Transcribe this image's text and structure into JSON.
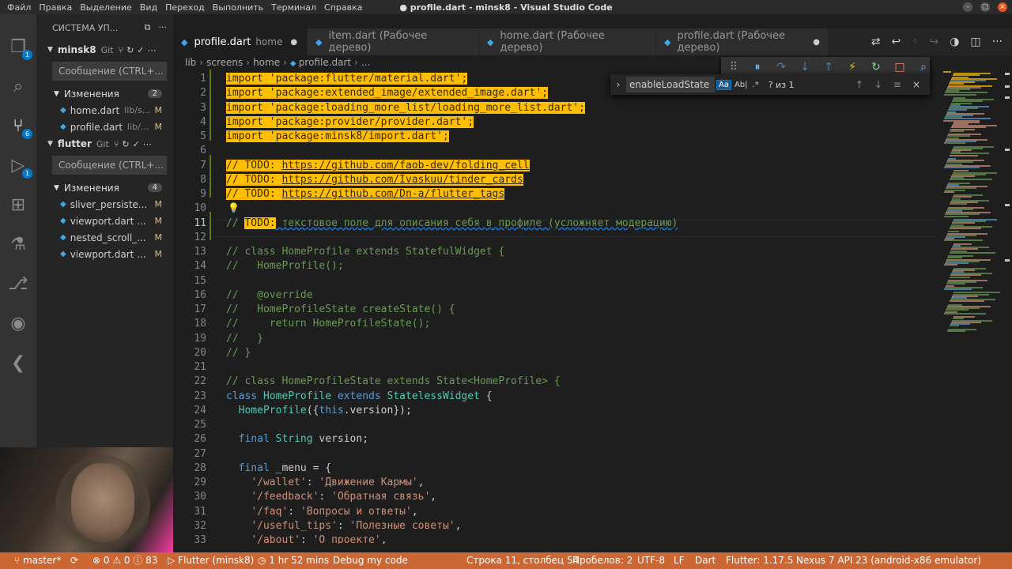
{
  "window": {
    "title": "● profile.dart - minsk8 - Visual Studio Code"
  },
  "menu": [
    "Файл",
    "Правка",
    "Выделение",
    "Вид",
    "Переход",
    "Выполнить",
    "Терминал",
    "Справка"
  ],
  "activity": [
    {
      "name": "explorer-icon",
      "badge": "1"
    },
    {
      "name": "search-icon",
      "badge": ""
    },
    {
      "name": "source-control-icon",
      "badge": "6"
    },
    {
      "name": "run-debug-icon",
      "badge": "1"
    },
    {
      "name": "extensions-icon",
      "badge": ""
    },
    {
      "name": "testing-flask-icon",
      "badge": ""
    },
    {
      "name": "git-graph-icon",
      "badge": ""
    },
    {
      "name": "docker-icon",
      "badge": ""
    },
    {
      "name": "flutter-icon",
      "badge": ""
    }
  ],
  "sidebar": {
    "title": "СИСТЕМА УП...",
    "repos": [
      {
        "name": "minsk8",
        "tag": "Git",
        "message_placeholder": "Сообщение (CTRL+...",
        "changes_label": "Изменения",
        "changes_count": "2",
        "files": [
          {
            "name": "home.dart",
            "path": "lib/s...",
            "status": "M"
          },
          {
            "name": "profile.dart",
            "path": "lib/...",
            "status": "M"
          }
        ]
      },
      {
        "name": "flutter",
        "tag": "Git",
        "message_placeholder": "Сообщение (CTRL+...",
        "changes_label": "Изменения",
        "changes_count": "4",
        "files": [
          {
            "name": "sliver_persiste...",
            "path": "",
            "status": "M"
          },
          {
            "name": "viewport.dart ...",
            "path": "",
            "status": "M"
          },
          {
            "name": "nested_scroll_...",
            "path": "",
            "status": "M"
          },
          {
            "name": "viewport.dart ...",
            "path": "",
            "status": "M"
          }
        ]
      }
    ]
  },
  "tabs": [
    {
      "label": "profile.dart",
      "sub": "home",
      "dirty": "●",
      "active": true
    },
    {
      "label": "item.dart (Рабочее дерево)",
      "sub": "",
      "dirty": "",
      "active": false
    },
    {
      "label": "home.dart (Рабочее дерево)",
      "sub": "",
      "dirty": "",
      "active": false
    },
    {
      "label": "profile.dart (Рабочее дерево)",
      "sub": "",
      "dirty": "●",
      "active": false
    }
  ],
  "breadcrumb": [
    "lib",
    "screens",
    "home",
    "profile.dart",
    "..."
  ],
  "find": {
    "query": "enableLoadState",
    "match_case": "Aa",
    "whole_word": "Ab|",
    "regex": ".*",
    "result": "? из 1"
  },
  "editor": {
    "lines": [
      {
        "n": "1",
        "html": "<span class=\"hl\">import 'package:flutter/material.dart';</span>"
      },
      {
        "n": "2",
        "html": "<span class=\"hl\">import 'package:extended_image/extended_image.dart';</span>"
      },
      {
        "n": "3",
        "html": "<span class=\"hl\">import 'package:loading_more_list/loading_more_list.dart';</span>"
      },
      {
        "n": "4",
        "html": "<span class=\"hl\">import 'package:provider/provider.dart';</span>"
      },
      {
        "n": "5",
        "html": "<span class=\"hl\">import 'package:minsk8/import.dart';</span>"
      },
      {
        "n": "6",
        "html": ""
      },
      {
        "n": "7",
        "html": "<span class=\"hl\">// TODO: <u>https://github.com/faob-dev/folding_cell</u></span>"
      },
      {
        "n": "8",
        "html": "<span class=\"hl\">// TODO: <u>https://github.com/Ivaskuu/tinder_cards</u></span>"
      },
      {
        "n": "9",
        "html": "<span class=\"hl\">// TODO: <u>https://github.com/Dn-a/flutter_tags</u></span>"
      },
      {
        "n": "10",
        "html": ""
      },
      {
        "n": "11",
        "html": "<span class=\"c\">// </span><span class=\"hl\">TODO:</span><span class=\"wavy\"> текстовое поле для описания себя в профиле (усложняет модерацию)</span>"
      },
      {
        "n": "12",
        "html": ""
      },
      {
        "n": "13",
        "html": "<span class=\"c\">// class HomeProfile extends StatefulWidget {</span>"
      },
      {
        "n": "14",
        "html": "<span class=\"c\">//   HomeProfile();</span>"
      },
      {
        "n": "15",
        "html": ""
      },
      {
        "n": "16",
        "html": "<span class=\"c\">//   @override</span>"
      },
      {
        "n": "17",
        "html": "<span class=\"c\">//   HomeProfileState createState() {</span>"
      },
      {
        "n": "18",
        "html": "<span class=\"c\">//     return HomeProfileState();</span>"
      },
      {
        "n": "19",
        "html": "<span class=\"c\">//   }</span>"
      },
      {
        "n": "20",
        "html": "<span class=\"c\">// }</span>"
      },
      {
        "n": "21",
        "html": ""
      },
      {
        "n": "22",
        "html": "<span class=\"c\">// class HomeProfileState extends State&lt;HomeProfile&gt; {</span>"
      },
      {
        "n": "23",
        "html": "<span class=\"k\">class</span> <span class=\"t\">HomeProfile</span> <span class=\"k\">extends</span> <span class=\"t\">StatelessWidget</span> {"
      },
      {
        "n": "24",
        "html": "  <span class=\"t\">HomeProfile</span>({<span class=\"k\">this</span>.version});"
      },
      {
        "n": "25",
        "html": ""
      },
      {
        "n": "26",
        "html": "  <span class=\"k\">final</span> <span class=\"t\">String</span> version;"
      },
      {
        "n": "27",
        "html": ""
      },
      {
        "n": "28",
        "html": "  <span class=\"k\">final</span> _menu = {"
      },
      {
        "n": "29",
        "html": "    <span class=\"s\">'/wallet'</span>: <span class=\"s\">'Движение Кармы'</span>,"
      },
      {
        "n": "30",
        "html": "    <span class=\"s\">'/feedback'</span>: <span class=\"s\">'Обратная связь'</span>,"
      },
      {
        "n": "31",
        "html": "    <span class=\"s\">'/faq'</span>: <span class=\"s\">'Вопросы и ответы'</span>,"
      },
      {
        "n": "32",
        "html": "    <span class=\"s\">'/useful_tips'</span>: <span class=\"s\">'Полезные советы'</span>,"
      },
      {
        "n": "33",
        "html": "    <span class=\"s\">'/about'</span>: <span class=\"s\">'О проекте'</span>,"
      }
    ]
  },
  "status": {
    "branch": "master*",
    "problems": "⊗ 0 ⚠ 0 ⓘ 83",
    "flutter_proj": "Flutter (minsk8)",
    "time": "1 hr 52 mins",
    "debug": "Debug my code",
    "position": "Строка 11, столбец 54",
    "spaces": "Пробелов: 2",
    "encoding": "UTF-8",
    "eol": "LF",
    "lang": "Dart",
    "flutter_ver": "Flutter: 1.17.5",
    "device": "Nexus 7 API 23 (android-x86 emulator)"
  }
}
